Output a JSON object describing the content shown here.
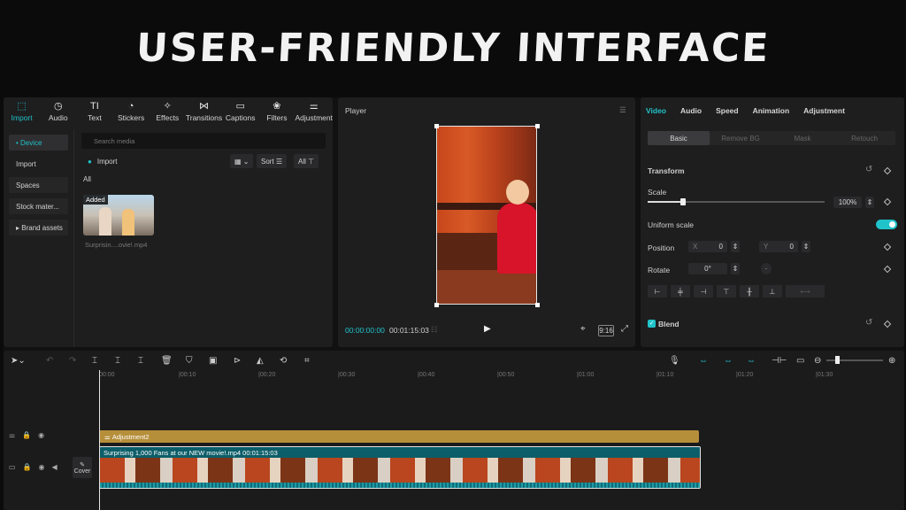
{
  "banner": {
    "title": "USER-FRIENDLY INTERFACE"
  },
  "media": {
    "tools": [
      {
        "label": "Import",
        "icon": "import-icon",
        "glyph": "⬚"
      },
      {
        "label": "Audio",
        "icon": "audio-icon",
        "glyph": "◷"
      },
      {
        "label": "Text",
        "icon": "text-icon",
        "glyph": "TI"
      },
      {
        "label": "Stickers",
        "icon": "sticker-icon",
        "glyph": "◔"
      },
      {
        "label": "Effects",
        "icon": "effects-icon",
        "glyph": "✧"
      },
      {
        "label": "Transitions",
        "icon": "transitions-icon",
        "glyph": "⋈"
      },
      {
        "label": "Captions",
        "icon": "captions-icon",
        "glyph": "▭"
      },
      {
        "label": "Filters",
        "icon": "filters-icon",
        "glyph": "❀"
      },
      {
        "label": "Adjustment",
        "icon": "adjustment-icon",
        "glyph": "⚌"
      }
    ],
    "nav": [
      "• Device",
      "Import",
      "Spaces",
      "Stock mater...",
      "▸ Brand assets"
    ],
    "search_placeholder": "Search media",
    "import_label": "Import",
    "sort_label": "Sort",
    "all_filter": "All",
    "section": "All",
    "thumb_badge": "Added",
    "thumb_name": "Surprisin....ovie!.mp4"
  },
  "player": {
    "title": "Player",
    "current_time": "00:00:00:00",
    "total_time": "00:01:15:03",
    "ratio": "9:16"
  },
  "details": {
    "tabs": [
      "Video",
      "Audio",
      "Speed",
      "Animation",
      "Adjustment"
    ],
    "subtabs": [
      "Basic",
      "Remove BG",
      "Mask",
      "Retouch"
    ],
    "transform": "Transform",
    "scale": "Scale",
    "scale_value": "100%",
    "uniform": "Uniform scale",
    "position": "Position",
    "pos_x_label": "X",
    "pos_x": "0",
    "pos_y_label": "Y",
    "pos_y": "0",
    "rotate": "Rotate",
    "rotate_value": "0°",
    "blend": "Blend",
    "accent": "#1fc3c9"
  },
  "timeline": {
    "ruler": [
      "00:00",
      "|00:10",
      "|00:20",
      "|00:30",
      "|00:40",
      "|00:50",
      "|01:00",
      "|01:10",
      "|01:20",
      "|01:30"
    ],
    "adjustment_label": "Adjustment2",
    "clip_label": "Surprising 1,000 Fans at our NEW movie!.mp4   00:01:15:03",
    "cover_label": "Cover"
  }
}
